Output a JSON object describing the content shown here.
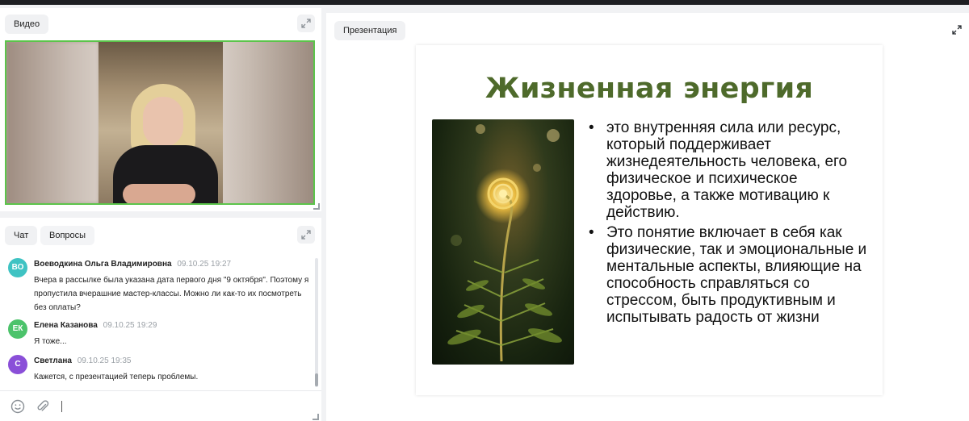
{
  "video": {
    "tab_label": "Видео"
  },
  "chat": {
    "tabs": [
      {
        "label": "Чат"
      },
      {
        "label": "Вопросы"
      }
    ],
    "messages": [
      {
        "initials": "ВО",
        "avatar_color": "#3fc3c3",
        "author": "Воеводкина Ольга Владимировна",
        "time": "09.10.25 19:27",
        "text": "Вчера в рассылке была указана дата первого дня \"9 октября\". Поэтому я пропустила вчерашние мастер-классы. Можно ли как-то их посмотреть без оплаты?"
      },
      {
        "initials": "ЕК",
        "avatar_color": "#4cc36b",
        "author": "Елена Казанова",
        "time": "09.10.25 19:29",
        "text": "Я тоже..."
      },
      {
        "initials": "С",
        "avatar_color": "#8a4fd8",
        "author": "Светлана",
        "time": "09.10.25 19:35",
        "text": "Кажется, с презентацией теперь проблемы."
      }
    ],
    "composer": {
      "value": "",
      "placeholder": "",
      "emoji_icon": "smile-icon",
      "attach_icon": "paperclip-icon"
    }
  },
  "presentation": {
    "tab_label": "Презентация",
    "slide": {
      "title": "Жизненная энергия",
      "bullets": [
        "это внутренняя сила или ресурс, который поддерживает жизнедеятельность человека, его физическое и психическое здоровье, а также мотивацию к действию.",
        "Это понятие включает в себя как физические, так и эмоциональные и ментальные аспекты, влияющие на способность справляться со стрессом, быть продуктивным и испытывать радость от жизни"
      ]
    }
  },
  "colors": {
    "accent_green": "#5cc44b",
    "title_green": "#4e6a2b"
  }
}
